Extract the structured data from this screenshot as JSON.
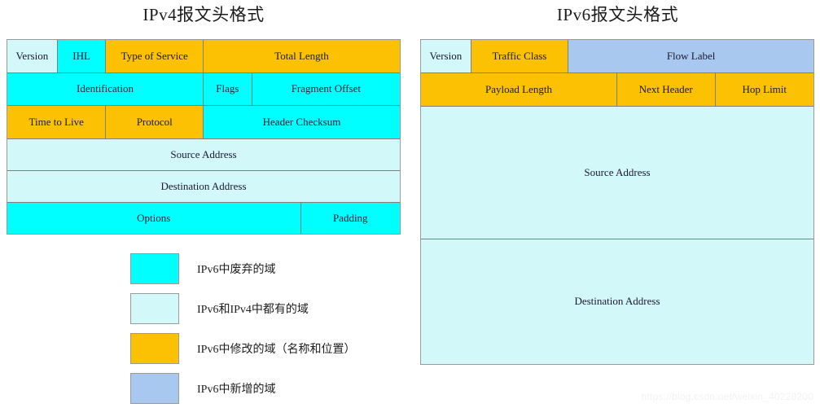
{
  "diagrams": [
    {
      "id": "ipv4",
      "title": "IPv4报文头格式",
      "rows": [
        {
          "height_pct": 17.1,
          "cells": [
            {
              "label": "Version",
              "width_pct": 12.8,
              "category": "common"
            },
            {
              "label": "IHL",
              "width_pct": 12.4,
              "category": "deprecated"
            },
            {
              "label": "Type of Service",
              "width_pct": 24.8,
              "category": "modified"
            },
            {
              "label": "Total Length",
              "width_pct": 50.0,
              "category": "modified"
            }
          ]
        },
        {
          "height_pct": 17.1,
          "cells": [
            {
              "label": "Identification",
              "width_pct": 50.0,
              "category": "deprecated"
            },
            {
              "label": "Flags",
              "width_pct": 12.4,
              "category": "deprecated"
            },
            {
              "label": "Fragment Offset",
              "width_pct": 37.6,
              "category": "deprecated"
            }
          ]
        },
        {
          "height_pct": 17.1,
          "cells": [
            {
              "label": "Time to Live",
              "width_pct": 25.2,
              "category": "modified"
            },
            {
              "label": "Protocol",
              "width_pct": 24.8,
              "category": "modified"
            },
            {
              "label": "Header Checksum",
              "width_pct": 50.0,
              "category": "deprecated"
            }
          ]
        },
        {
          "height_pct": 16.3,
          "cells": [
            {
              "label": "Source Address",
              "width_pct": 100,
              "category": "common"
            }
          ]
        },
        {
          "height_pct": 16.3,
          "cells": [
            {
              "label": "Destination Address",
              "width_pct": 100,
              "category": "common"
            }
          ]
        },
        {
          "height_pct": 16.1,
          "cells": [
            {
              "label": "Options",
              "width_pct": 74.8,
              "category": "deprecated"
            },
            {
              "label": "Padding",
              "width_pct": 25.2,
              "category": "deprecated"
            }
          ]
        }
      ]
    },
    {
      "id": "ipv6",
      "title": "IPv6报文头格式",
      "rows": [
        {
          "height_pct": 10.3,
          "cells": [
            {
              "label": "Version",
              "width_pct": 12.8,
              "category": "common"
            },
            {
              "label": "Traffic Class",
              "width_pct": 24.8,
              "category": "modified"
            },
            {
              "label": "Flow Label",
              "width_pct": 62.4,
              "category": "new"
            }
          ]
        },
        {
          "height_pct": 10.3,
          "cells": [
            {
              "label": "Payload Length",
              "width_pct": 50.0,
              "category": "modified"
            },
            {
              "label": "Next Header",
              "width_pct": 25.0,
              "category": "modified"
            },
            {
              "label": "Hop Limit",
              "width_pct": 25.0,
              "category": "modified"
            }
          ]
        },
        {
          "height_pct": 41.0,
          "cells": [
            {
              "label": "Source Address",
              "width_pct": 100,
              "category": "common"
            }
          ]
        },
        {
          "height_pct": 38.4,
          "cells": [
            {
              "label": "Destination Address",
              "width_pct": 100,
              "category": "common"
            }
          ]
        }
      ]
    }
  ],
  "legend": {
    "items": [
      {
        "label": "IPv6中废弃的域",
        "category": "deprecated"
      },
      {
        "label": "IPv6和IPv4中都有的域",
        "category": "common"
      },
      {
        "label": "IPv6中修改的域（名称和位置）",
        "category": "modified"
      },
      {
        "label": "IPv6中新增的域",
        "category": "new"
      }
    ]
  },
  "colors": {
    "deprecated": "#00ffff",
    "common": "#d2f8fa",
    "modified": "#fbc102",
    "new": "#a8c8f0"
  },
  "watermark": "https://blog.csdn.net/weixin_40228200"
}
